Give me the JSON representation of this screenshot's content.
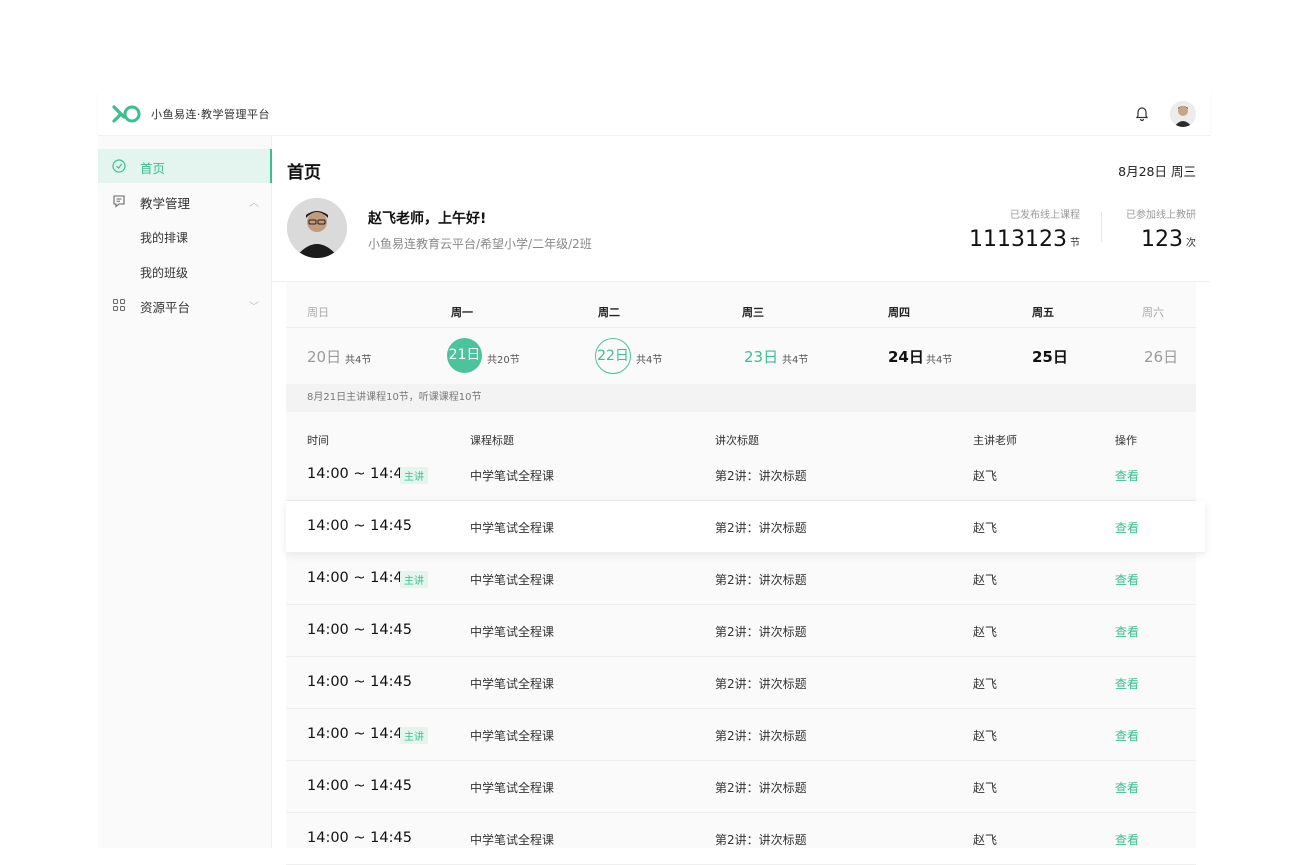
{
  "brand": "小鱼易连·教学管理平台",
  "colors": {
    "accent": "#3cbf8e"
  },
  "sidebar": {
    "home": "首页",
    "teaching": "教学管理",
    "my_schedule": "我的排课",
    "my_class": "我的班级",
    "resources": "资源平台"
  },
  "page": {
    "title": "首页",
    "date": "8月28日 周三"
  },
  "profile": {
    "greeting": "赵飞老师，上午好!",
    "org": "小鱼易连教育云平台/希望小学/二年级/2班",
    "stat1_caption": "已发布线上课程",
    "stat1_value": "1113123",
    "stat1_unit": "节",
    "stat2_caption": "已参加线上教研",
    "stat2_value": "123",
    "stat2_unit": "次"
  },
  "calendar": {
    "weekdays": [
      "周日",
      "周一",
      "周二",
      "周三",
      "周四",
      "周五",
      "周六"
    ],
    "days": [
      "20日",
      "21日",
      "22日",
      "23日",
      "24日",
      "25日",
      "26日"
    ],
    "counts": [
      "共4节",
      "共20节",
      "共4节",
      "共4节",
      "共4节"
    ],
    "summary": "8月21日主讲课程10节，听课课程10节"
  },
  "table": {
    "headers": [
      "时间",
      "课程标题",
      "讲次标题",
      "主讲老师",
      "操作"
    ],
    "tag_label": "主讲",
    "rows": [
      {
        "time": "14:00 ~ 14:45",
        "course": "中学笔试全程课",
        "lesson": "第2讲：讲次标题",
        "teacher": "赵飞",
        "action": "查看"
      },
      {
        "time": "14:00 ~ 14:45",
        "course": "中学笔试全程课",
        "lesson": "第2讲：讲次标题",
        "teacher": "赵飞",
        "action": "查看"
      },
      {
        "time": "14:00 ~ 14:45",
        "course": "中学笔试全程课",
        "lesson": "第2讲：讲次标题",
        "teacher": "赵飞",
        "action": "查看"
      },
      {
        "time": "14:00 ~ 14:45",
        "course": "中学笔试全程课",
        "lesson": "第2讲：讲次标题",
        "teacher": "赵飞",
        "action": "查看"
      },
      {
        "time": "14:00 ~ 14:45",
        "course": "中学笔试全程课",
        "lesson": "第2讲：讲次标题",
        "teacher": "赵飞",
        "action": "查看"
      },
      {
        "time": "14:00 ~ 14:45",
        "course": "中学笔试全程课",
        "lesson": "第2讲：讲次标题",
        "teacher": "赵飞",
        "action": "查看"
      },
      {
        "time": "14:00 ~ 14:45",
        "course": "中学笔试全程课",
        "lesson": "第2讲：讲次标题",
        "teacher": "赵飞",
        "action": "查看"
      },
      {
        "time": "14:00 ~ 14:45",
        "course": "中学笔试全程课",
        "lesson": "第2讲：讲次标题",
        "teacher": "赵飞",
        "action": "查看"
      }
    ]
  }
}
